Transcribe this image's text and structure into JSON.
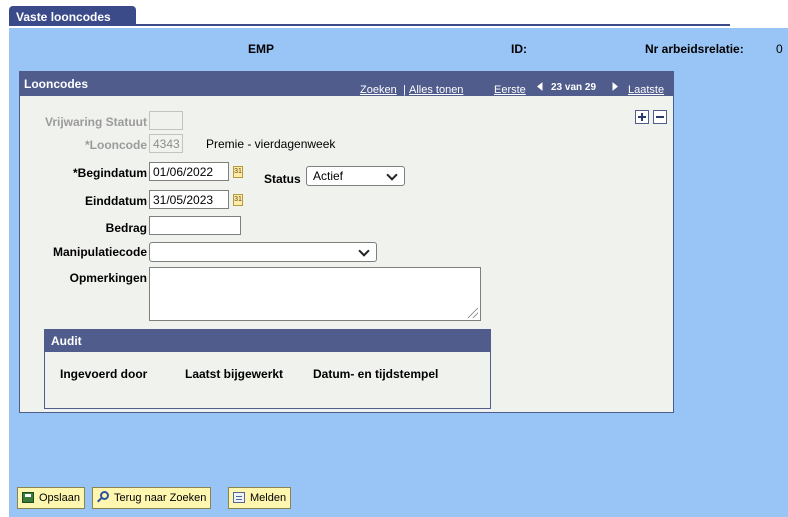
{
  "tab": {
    "label": "Vaste looncodes"
  },
  "header": {
    "emp_label": "EMP",
    "id_label": "ID:",
    "relation_label": "Nr arbeidsrelatie:",
    "relation_value": "0"
  },
  "panel": {
    "title": "Looncodes",
    "search_link": "Zoeken",
    "show_all_link": "Alles tonen",
    "separator": "|",
    "first_link": "Eerste",
    "count": "23 van 29",
    "last_link": "Laatste"
  },
  "form": {
    "vrijwaring_label": "Vrijwaring Statuut",
    "vrijwaring_value": "",
    "looncode_label": "*Looncode",
    "looncode_value": "4343",
    "looncode_description": "Premie - vierdagenweek",
    "begindatum_label": "*Begindatum",
    "begindatum_value": "01/06/2022",
    "einddatum_label": "Einddatum",
    "einddatum_value": "31/05/2023",
    "status_label": "Status",
    "status_value": "Actief",
    "bedrag_label": "Bedrag",
    "bedrag_value": "",
    "manipulatie_label": "Manipulatiecode",
    "manipulatie_value": "",
    "opmerkingen_label": "Opmerkingen",
    "opmerkingen_value": "",
    "calendar_glyph": "31"
  },
  "audit": {
    "title": "Audit",
    "entered_by": "Ingevoerd door",
    "last_updated": "Laatst bijgewerkt",
    "timestamp": "Datum- en tijdstempel"
  },
  "toolbar": {
    "save": "Opslaan",
    "back": "Terug naar Zoeken",
    "notify": "Melden"
  },
  "icons": {
    "save": "save-icon",
    "back": "search-icon",
    "notify": "notify-icon",
    "calendar": "calendar-icon",
    "prev": "prev-arrow-icon",
    "next": "next-arrow-icon"
  },
  "colors": {
    "header_bar": "#4f5c8c",
    "tab": "#3b4b8a",
    "page_background": "#99c4f6",
    "panel_background": "#f0f2ee",
    "button": "#fff7b0"
  }
}
